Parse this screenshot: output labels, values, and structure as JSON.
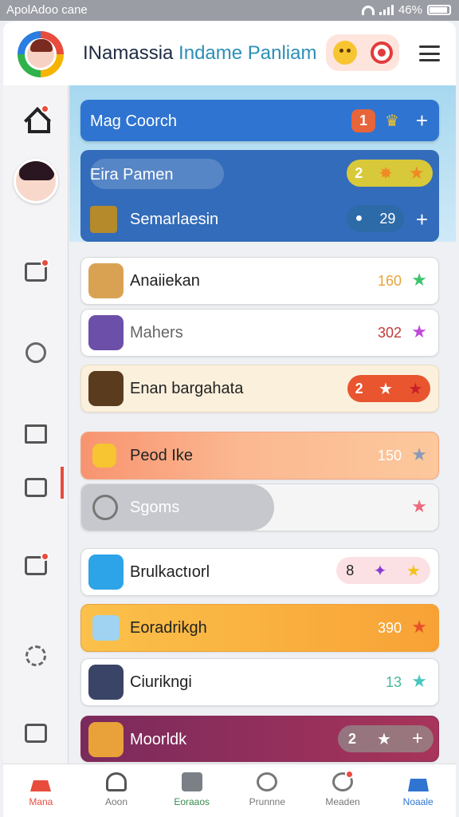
{
  "status_bar": {
    "app_name": "ApolAdoo cane",
    "battery": "46%"
  },
  "header": {
    "title_main": "INamassia",
    "title_accent": "Indame Panliam"
  },
  "hero": {
    "bar": {
      "label": "Mag Coorch",
      "count": "1"
    },
    "panel_rows": [
      {
        "label": "Eira Pamen",
        "count": "2"
      },
      {
        "label": "Semarlaesin",
        "value": "29"
      }
    ]
  },
  "rows": [
    {
      "label": "Anaiiekan",
      "value": "160",
      "star_color": "#3ec46d"
    },
    {
      "label": "Mahers",
      "value": "302",
      "star_color": "#c04ad9"
    },
    {
      "label": "Enan bargahata",
      "count": "2"
    },
    {
      "label": "Peod Ike",
      "value": "150"
    },
    {
      "label": "Sgoms"
    },
    {
      "label": "Brulkactıorl",
      "count": "8"
    },
    {
      "label": "Eoradrikgh",
      "value": "390"
    },
    {
      "label": "Ciurikngi",
      "value": "13"
    },
    {
      "label": "Moorldk",
      "count": "2"
    }
  ],
  "bottom_nav": [
    {
      "label": "Mana",
      "icon": "home-icon",
      "active": true
    },
    {
      "label": "Aoon",
      "icon": "user-icon"
    },
    {
      "label": "Eoraaos",
      "icon": "list-icon"
    },
    {
      "label": "Prunnne",
      "icon": "compass-icon"
    },
    {
      "label": "Meaden",
      "icon": "puzzle-icon"
    },
    {
      "label": "Noaale",
      "icon": "house-icon",
      "active": true
    }
  ],
  "colors": {
    "brand_red": "#e84c3d",
    "brand_blue": "#2f74d0",
    "orange": "#f7a940"
  }
}
